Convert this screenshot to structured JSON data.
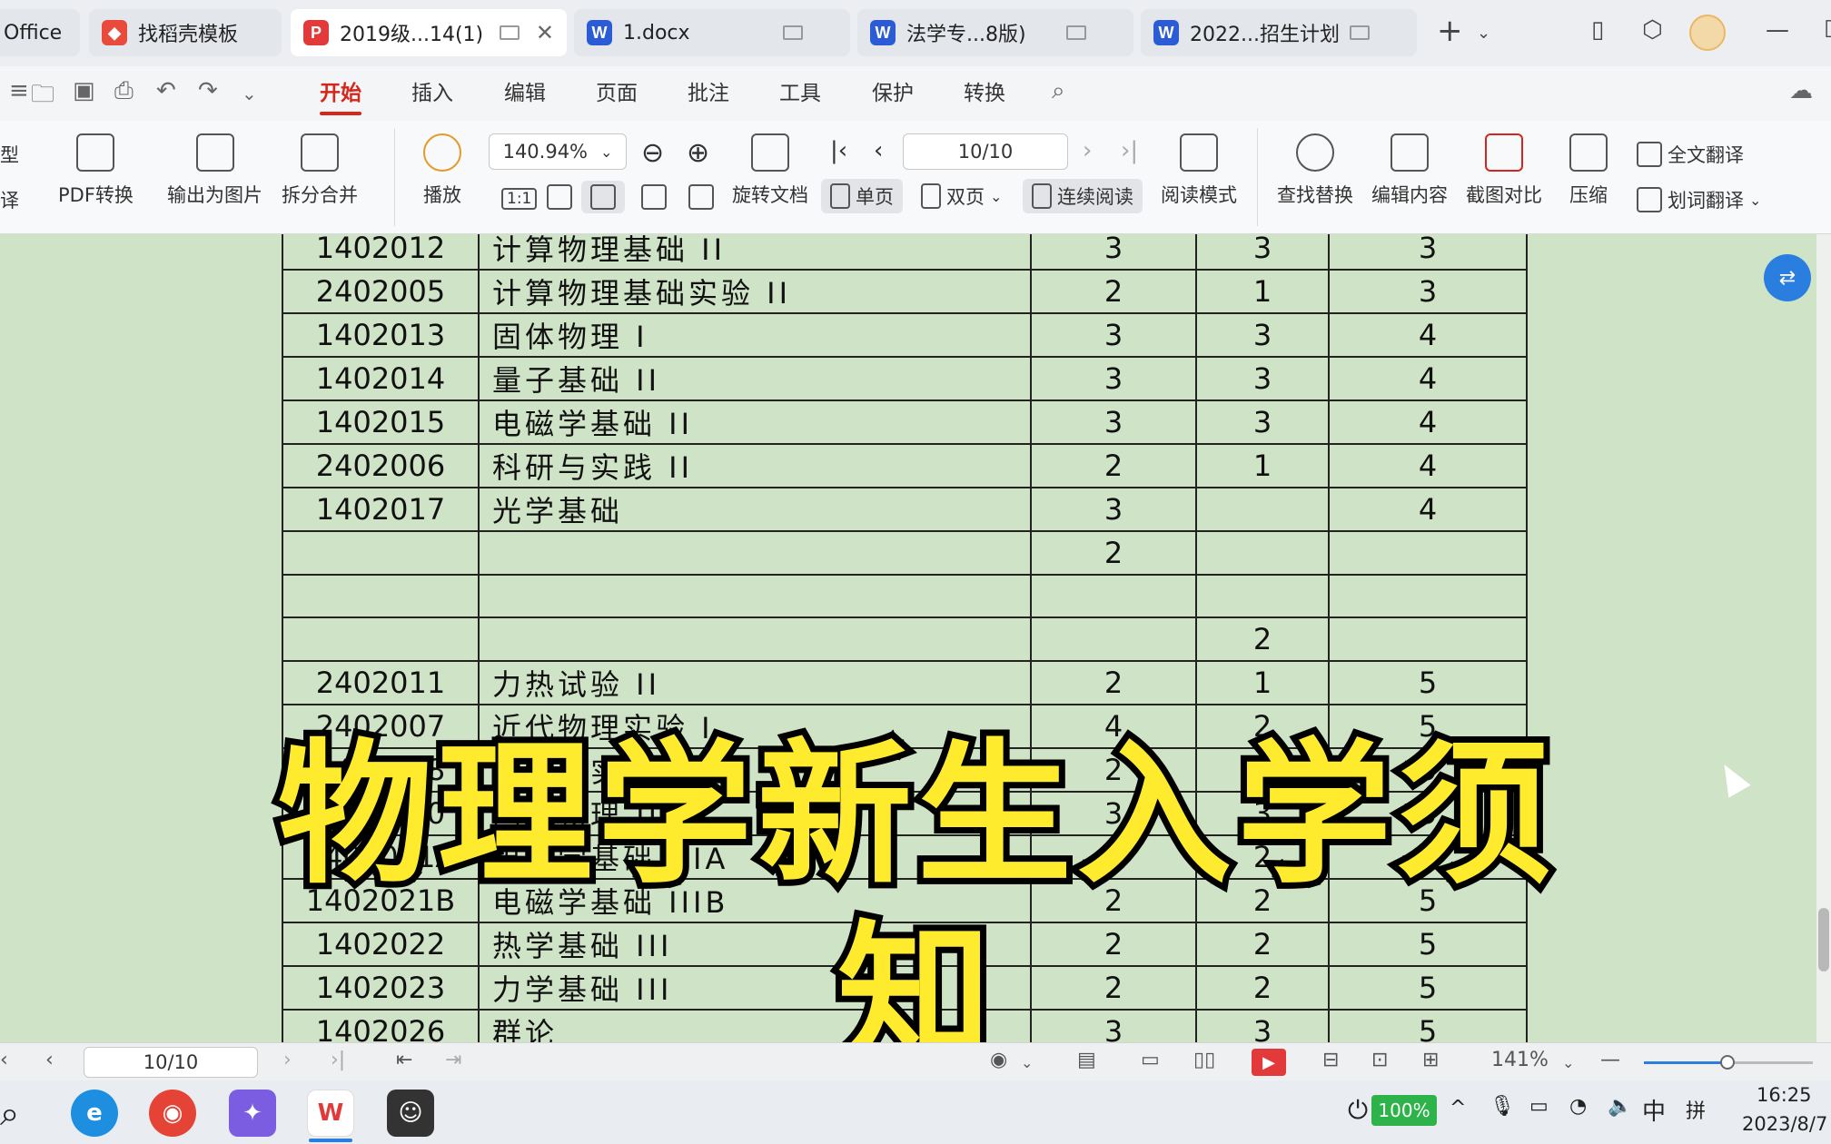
{
  "tabs": [
    {
      "label": "Office",
      "icon": "wps-icon"
    },
    {
      "label": "找稻壳模板",
      "icon": "docer-icon"
    },
    {
      "label": "2019级...14(1)",
      "icon": "pdf-icon",
      "active": true
    },
    {
      "label": "1.docx",
      "icon": "word-icon"
    },
    {
      "label": "法学专...8版)",
      "icon": "word-icon"
    },
    {
      "label": "2022...招生计划",
      "icon": "word-icon"
    }
  ],
  "tab_icon_letters": {
    "pdf": "P",
    "word": "W",
    "docer": "◆"
  },
  "menu": [
    "开始",
    "插入",
    "编辑",
    "页面",
    "批注",
    "工具",
    "保护",
    "转换"
  ],
  "ribbon": {
    "left_cut_top": "型",
    "left_cut_bottom": "译",
    "pdf_convert": "PDF转换",
    "export_image": "输出为图片",
    "split_merge": "拆分合并",
    "play": "播放",
    "zoom": "140.94%",
    "rotate": "旋转文档",
    "page_input": "10/10",
    "single_page": "单页",
    "double_page": "双页",
    "continuous": "连续阅读",
    "reading_mode": "阅读模式",
    "find_replace": "查找替换",
    "edit_content": "编辑内容",
    "screenshot_compare": "截图对比",
    "compress": "压缩",
    "full_translate": "全文翻译",
    "word_translate": "划词翻译",
    "one_to_one": "1:1"
  },
  "table_rows": [
    {
      "code": "1402012",
      "name": "计算物理基础 II",
      "a": "3",
      "b": "3",
      "c": "3"
    },
    {
      "code": "2402005",
      "name": "计算物理基础实验 II",
      "a": "2",
      "b": "1",
      "c": "3"
    },
    {
      "code": "1402013",
      "name": "固体物理 I",
      "a": "3",
      "b": "3",
      "c": "4"
    },
    {
      "code": "1402014",
      "name": "量子基础 II",
      "a": "3",
      "b": "3",
      "c": "4"
    },
    {
      "code": "1402015",
      "name": "电磁学基础 II",
      "a": "3",
      "b": "3",
      "c": "4"
    },
    {
      "code": "2402006",
      "name": "科研与实践 II",
      "a": "2",
      "b": "1",
      "c": "4"
    },
    {
      "code": "1402017",
      "name": "光学基础",
      "a": "3",
      "b": "",
      "c": "4"
    },
    {
      "code": "",
      "name": "",
      "a": "2",
      "b": "",
      "c": ""
    },
    {
      "code": "",
      "name": "",
      "a": "",
      "b": "",
      "c": ""
    },
    {
      "code": "",
      "name": "",
      "a": "",
      "b": "2",
      "c": ""
    },
    {
      "code": "2402011",
      "name": "力热试验 II",
      "a": "2",
      "b": "1",
      "c": "5"
    },
    {
      "code": "2402007",
      "name": "近代物理实验 I",
      "a": "4",
      "b": "2",
      "c": "5"
    },
    {
      "code": "2402008",
      "name": "科研与实践 III",
      "a": "2",
      "b": "1",
      "c": "5"
    },
    {
      "code": "1402020",
      "name": "固体物理 II",
      "a": "3",
      "b": "3",
      "c": "5"
    },
    {
      "code": "1402021A",
      "name": "电磁学基础 IIIA",
      "a": "2",
      "b": "2",
      "c": "5"
    },
    {
      "code": "1402021B",
      "name": "电磁学基础 IIIB",
      "a": "2",
      "b": "2",
      "c": "5"
    },
    {
      "code": "1402022",
      "name": "热学基础 III",
      "a": "2",
      "b": "2",
      "c": "5"
    },
    {
      "code": "1402023",
      "name": "力学基础 III",
      "a": "2",
      "b": "2",
      "c": "5"
    },
    {
      "code": "1402026",
      "name": "群论",
      "a": "3",
      "b": "3",
      "c": "5"
    }
  ],
  "overlay_title": "物理学新生入学须知",
  "status": {
    "page": "10/10",
    "zoom": "141%"
  },
  "taskbar": {
    "battery": "100%",
    "ime_lang": "中",
    "ime_mode": "拼",
    "time": "16:25",
    "date": "2023/8/7"
  },
  "colors": {
    "doc_bg": "#cfe3c6",
    "accent": "#d4261a",
    "overlay_fill": "#ffeb2e",
    "word_blue": "#2b5cd6",
    "pdf_red": "#e23a3a"
  }
}
